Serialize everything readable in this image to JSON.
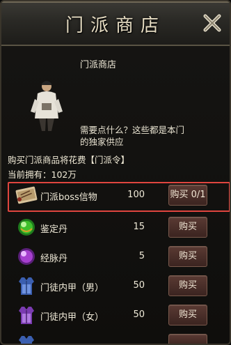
{
  "window": {
    "title": "门派商店"
  },
  "npc": {
    "shop_name": "门派商店",
    "greeting": "需要点什么？这些都是本门的独家供应"
  },
  "shop_info": {
    "cost_text": "购买门派商品将花费【门派令】",
    "owned_text": "当前拥有：102万"
  },
  "items": [
    {
      "name": "门派boss信物",
      "price": "100",
      "buy_label": "购买 0/1",
      "icon": "scroll-icon",
      "selected": true
    },
    {
      "name": "鉴定丹",
      "price": "15",
      "buy_label": "购买",
      "icon": "green-orb-icon"
    },
    {
      "name": "经脉丹",
      "price": "5",
      "buy_label": "购买",
      "icon": "purple-orb-icon"
    },
    {
      "name": "门徒内甲（男）",
      "price": "50",
      "buy_label": "购买",
      "icon": "blue-vest-icon"
    },
    {
      "name": "门徒内甲（女）",
      "price": "50",
      "buy_label": "购买",
      "icon": "purple-vest-icon"
    }
  ],
  "colors": {
    "highlight_border": "#e0453f",
    "button_bg": "#4a2e29"
  }
}
